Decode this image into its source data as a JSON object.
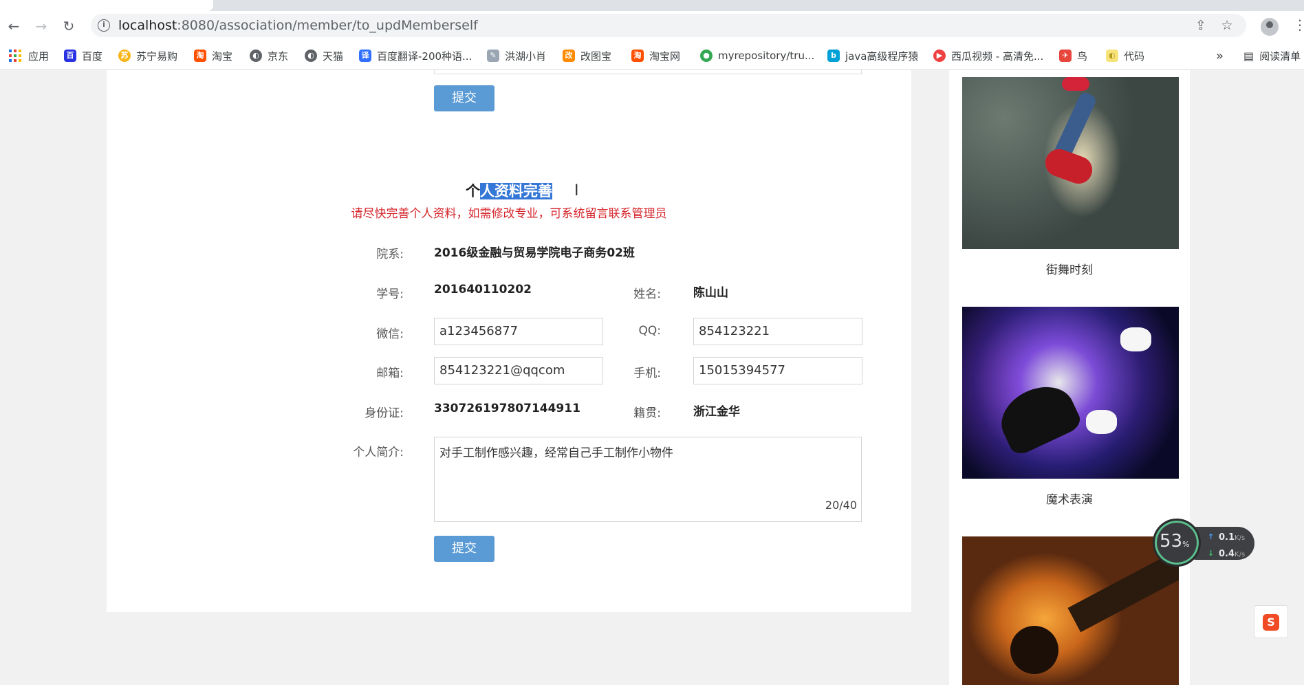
{
  "browser": {
    "url_host": "localhost",
    "url_path": ":8080/association/member/to_updMemberself",
    "bookmarks": [
      {
        "label": "应用",
        "icon": "apps-grid-icon"
      },
      {
        "label": "百度",
        "icon": "baidu-icon",
        "color": "#2932e1"
      },
      {
        "label": "苏宁易购",
        "icon": "suning-icon",
        "color": "#f9b517"
      },
      {
        "label": "淘宝",
        "icon": "taobao-icon",
        "color": "#ff5000"
      },
      {
        "label": "京东",
        "icon": "globe-icon",
        "color": "#5f6368"
      },
      {
        "label": "天猫",
        "icon": "globe-icon",
        "color": "#5f6368"
      },
      {
        "label": "百度翻译-200种语...",
        "icon": "baidu-translate-icon",
        "color": "#3170ff"
      },
      {
        "label": "洪湖小肖",
        "icon": "feather-icon",
        "color": "#9aa6b2"
      },
      {
        "label": "改图宝",
        "icon": "gaitubao-icon",
        "color": "#ff8a00"
      },
      {
        "label": "淘宝网",
        "icon": "taobao-icon",
        "color": "#ff5000"
      },
      {
        "label": "myrepository/tru...",
        "icon": "chrome-icon",
        "color": "#34a853"
      },
      {
        "label": "java高级程序猿",
        "icon": "bilibili-icon",
        "color": "#00a1d6"
      },
      {
        "label": "西瓜视频 - 高清免...",
        "icon": "xigua-icon",
        "color": "#f04142"
      },
      {
        "label": "鸟",
        "icon": "bird-icon",
        "color": "#e8453c"
      },
      {
        "label": "代码",
        "icon": "folder-icon",
        "color": "#f7e37a"
      }
    ],
    "overflow_label": "»",
    "reading_list_label": "阅读清单"
  },
  "form": {
    "submit_top": "提交",
    "title_plain": "个",
    "title_highlight": "人资料完善",
    "notice": "请尽快完善个人资料，如需修改专业，可系统留言联系管理员",
    "department_label": "院系:",
    "department_value": "2016级金融与贸易学院电子商务02班",
    "student_id_label": "学号:",
    "student_id_value": "201640110202",
    "name_label": "姓名:",
    "name_value": "陈山山",
    "wechat_label": "微信:",
    "wechat_value": "a123456877",
    "qq_label": "QQ:",
    "qq_value": "854123221",
    "email_label": "邮箱:",
    "email_value": "854123221@qqcom",
    "phone_label": "手机:",
    "phone_value": "15015394577",
    "id_card_label": "身份证:",
    "id_card_value": "330726197807144911",
    "hometown_label": "籍贯:",
    "hometown_value": "浙江金华",
    "bio_label": "个人简介:",
    "bio_value": "对手工制作感兴趣，经常自己手工制作小物件",
    "bio_counter": "20/40",
    "submit_bottom": "提交"
  },
  "sidebar": {
    "cards": [
      {
        "caption": "街舞时刻"
      },
      {
        "caption": "魔术表演"
      },
      {
        "caption": ""
      }
    ]
  },
  "widgets": {
    "speed_percent": "53",
    "percent_sign": "%",
    "upload": "0.1",
    "download": "0.4",
    "unit": "K/s",
    "ime_letter": "S"
  }
}
